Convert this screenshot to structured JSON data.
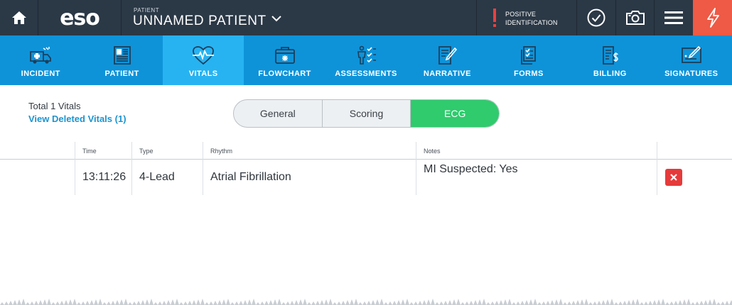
{
  "topbar": {
    "logo": "eso",
    "patient_caption": "PATIENT",
    "patient_name": "UNNAMED PATIENT",
    "positive_id_line1": "POSITIVE",
    "positive_id_line2": "IDENTIFICATION"
  },
  "nav": {
    "tabs": [
      {
        "label": "INCIDENT",
        "icon": "ambulance-icon",
        "active": false
      },
      {
        "label": "PATIENT",
        "icon": "patient-card-icon",
        "active": false
      },
      {
        "label": "VITALS",
        "icon": "heart-pulse-icon",
        "active": true
      },
      {
        "label": "FLOWCHART",
        "icon": "medical-case-icon",
        "active": false
      },
      {
        "label": "ASSESSMENTS",
        "icon": "body-checklist-icon",
        "active": false
      },
      {
        "label": "NARRATIVE",
        "icon": "document-pen-icon",
        "active": false
      },
      {
        "label": "FORMS",
        "icon": "checklist-form-icon",
        "active": false
      },
      {
        "label": "BILLING",
        "icon": "billing-document-icon",
        "active": false
      },
      {
        "label": "SIGNATURES",
        "icon": "signature-icon",
        "active": false
      }
    ]
  },
  "summary": {
    "total": "Total 1 Vitals",
    "deleted_link": "View Deleted Vitals (1)"
  },
  "segments": {
    "general": "General",
    "scoring": "Scoring",
    "ecg": "ECG",
    "active": "ECG"
  },
  "table": {
    "headers": {
      "time": "Time",
      "type": "Type",
      "rhythm": "Rhythm",
      "notes": "Notes"
    },
    "rows": [
      {
        "time": "13:11:26",
        "type": "4-Lead",
        "rhythm": "Atrial Fibrillation",
        "notes": "MI Suspected: Yes"
      }
    ]
  },
  "colors": {
    "topbar": "#2b3846",
    "nav": "#0e93d9",
    "nav_active": "#27b3f2",
    "segment_active": "#2fcb6d",
    "link": "#1d94cf",
    "danger": "#e63a3a",
    "flash_button": "#ee5a45"
  }
}
